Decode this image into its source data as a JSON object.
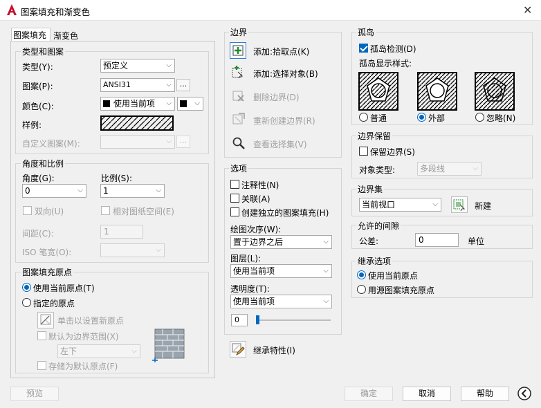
{
  "window": {
    "title": "图案填充和渐变色"
  },
  "tabs": [
    "图案填充",
    "渐变色"
  ],
  "type_pattern": {
    "legend": "类型和图案",
    "type_label": "类型(Y):",
    "type_value": "预定义",
    "pattern_label": "图案(P):",
    "pattern_value": "ANSI31",
    "ellipsis": "...",
    "color_label": "颜色(C):",
    "color_value": "使用当前项",
    "swatch_label": "样例:",
    "custom_label": "自定义图案(M):"
  },
  "angle_scale": {
    "legend": "角度和比例",
    "angle_label": "角度(G):",
    "angle_value": "0",
    "scale_label": "比例(S):",
    "scale_value": "1",
    "double_label": "双向(U)",
    "relative_label": "相对图纸空间(E)",
    "spacing_label": "间距(C):",
    "spacing_value": "1",
    "iso_label": "ISO 笔宽(O):"
  },
  "origin": {
    "legend": "图案填充原点",
    "use_current": "使用当前原点(T)",
    "specified": "指定的原点",
    "click_set": "单击以设置新原点",
    "default_extent": "默认为边界范围(X)",
    "position_value": "左下",
    "store_default": "存储为默认原点(F)"
  },
  "boundaries": {
    "legend": "边界",
    "add_pick": "添加:拾取点(K)",
    "add_select": "添加:选择对象(B)",
    "remove": "删除边界(D)",
    "recreate": "重新创建边界(R)",
    "view": "查看选择集(V)"
  },
  "options": {
    "legend": "选项",
    "annotative": "注释性(N)",
    "associative": "关联(A)",
    "separate": "创建独立的图案填充(H)",
    "draw_order_label": "绘图次序(W):",
    "draw_order_value": "置于边界之后",
    "layer_label": "图层(L):",
    "layer_value": "使用当前项",
    "transparency_label": "透明度(T):",
    "transparency_value": "使用当前项",
    "transparency_number": "0",
    "transparency_level": 0
  },
  "inherit_btn": "继承特性(I)",
  "islands": {
    "legend": "孤岛",
    "detect": "孤岛检测(D)",
    "style_label": "孤岛显示样式:",
    "normal": "普通",
    "outer": "外部",
    "ignore": "忽略(N)"
  },
  "retain": {
    "legend": "边界保留",
    "retain_label": "保留边界(S)",
    "object_type_label": "对象类型:",
    "object_type_value": "多段线"
  },
  "boundary_set": {
    "legend": "边界集",
    "value": "当前视口",
    "new_label": "新建"
  },
  "gap": {
    "legend": "允许的间隙",
    "tolerance_label": "公差:",
    "tolerance_value": "0",
    "unit": "单位"
  },
  "inherit_opts": {
    "legend": "继承选项",
    "use_current": "使用当前原点",
    "use_source": "用源图案填充原点"
  },
  "footer": {
    "preview": "预览",
    "ok": "确定",
    "cancel": "取消",
    "help": "帮助"
  },
  "colors": {
    "accent": "#0067c0",
    "logo": "#c8102e"
  }
}
